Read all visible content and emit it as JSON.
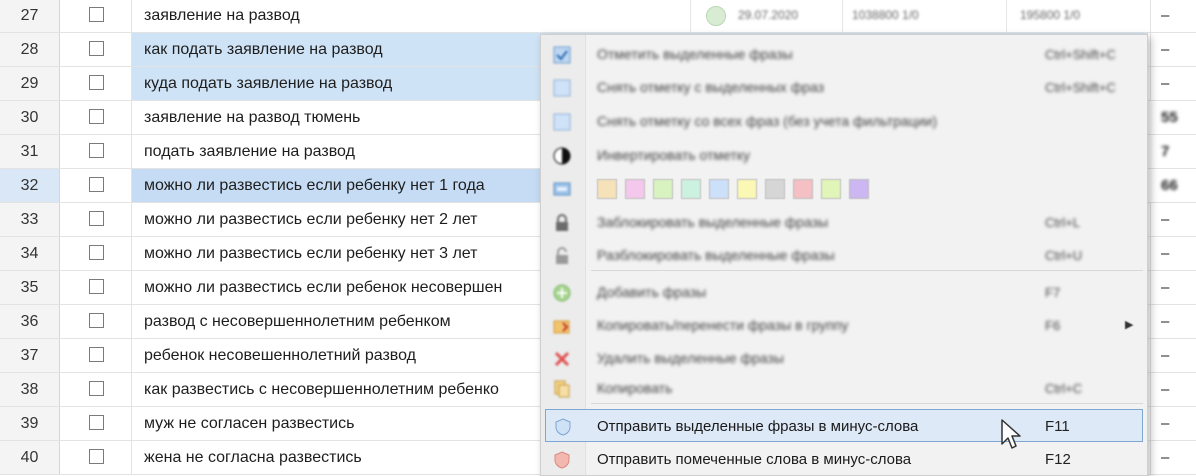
{
  "rows": [
    {
      "num": "27",
      "phrase": "заявление на развод",
      "stat": "–"
    },
    {
      "num": "28",
      "phrase": "как подать заявление на развод",
      "stat": "–"
    },
    {
      "num": "29",
      "phrase": "куда подать заявление на развод",
      "stat": "–"
    },
    {
      "num": "30",
      "phrase": "заявление на развод тюмень",
      "stat": "55"
    },
    {
      "num": "31",
      "phrase": "подать заявление на развод",
      "stat": "7"
    },
    {
      "num": "32",
      "phrase": "можно ли развестись если ребенку нет 1 года",
      "stat": "66"
    },
    {
      "num": "33",
      "phrase": "можно ли развестись если ребенку нет 2 лет",
      "stat": "–"
    },
    {
      "num": "34",
      "phrase": "можно ли развестись если ребенку нет 3 лет",
      "stat": "–"
    },
    {
      "num": "35",
      "phrase": "можно ли развестись если ребенок несовершен",
      "stat": "–"
    },
    {
      "num": "36",
      "phrase": "развод с несовершеннолетним ребенком",
      "stat": "–"
    },
    {
      "num": "37",
      "phrase": "ребенок несовешеннолетний развод",
      "stat": "–"
    },
    {
      "num": "38",
      "phrase": "как развестись с несовершеннолетним ребенко",
      "stat": "–"
    },
    {
      "num": "39",
      "phrase": "муж не согласен развестись",
      "stat": "–"
    },
    {
      "num": "40",
      "phrase": "жена не согласна развестись",
      "stat": "–"
    }
  ],
  "row27_extra": {
    "date": "29.07.2020",
    "count1": "1038800 1/0",
    "count2": "195800 1/0"
  },
  "menu": {
    "items": [
      {
        "label": "Отметить выделенные фразы",
        "shortcut": "Ctrl+Shift+C",
        "icon": "checkbox-checked-icon"
      },
      {
        "label": "Снять отметку с выделенных фраз",
        "shortcut": "Ctrl+Shift+C",
        "icon": "checkbox-empty-icon"
      },
      {
        "label": "Снять отметку со всех фраз (без учета фильтрации)",
        "shortcut": "",
        "icon": "checkbox-empty-icon"
      },
      {
        "label": "Инвертировать отметку",
        "shortcut": "",
        "icon": "invert-icon"
      },
      {
        "label": "",
        "shortcut": "",
        "icon": "color-marker-icon"
      },
      {
        "label": "Заблокировать выделенные фразы",
        "shortcut": "Ctrl+L",
        "icon": "lock-icon"
      },
      {
        "label": "Разблокировать выделенные фразы",
        "shortcut": "Ctrl+U",
        "icon": "unlock-icon"
      },
      {
        "label": "Добавить фразы",
        "shortcut": "F7",
        "icon": "add-icon"
      },
      {
        "label": "Копировать/перенести фразы в группу",
        "shortcut": "F6",
        "icon": "move-to-group-icon"
      },
      {
        "label": "Удалить выделенные фразы",
        "shortcut": "",
        "icon": "delete-icon"
      },
      {
        "label": "Копировать",
        "shortcut": "Ctrl+C",
        "icon": "copy-icon"
      },
      {
        "label": "Отправить выделенные фразы в минус-слова",
        "shortcut": "F11",
        "icon": "shield-blue-icon"
      },
      {
        "label": "Отправить помеченные слова в минус-слова",
        "shortcut": "F12",
        "icon": "shield-red-icon"
      }
    ],
    "swatch_colors": [
      "#f6e2b8",
      "#f3c8ec",
      "#d8f3c0",
      "#cdf1e0",
      "#cce0fa",
      "#fbf7b4",
      "#d6d6d6",
      "#f4c0c4",
      "#e2f5b8",
      "#ccb7f2"
    ]
  }
}
